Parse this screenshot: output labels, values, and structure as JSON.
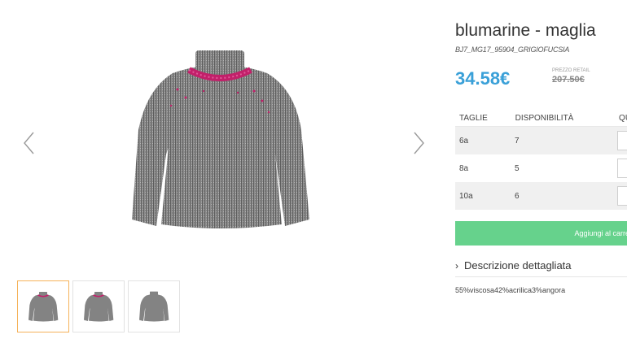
{
  "product": {
    "title": "blumarine - maglia",
    "sku": "BJ7_MG17_95904_GRIGIOFUCSIA",
    "price": "34.58€",
    "retail_label": "PREZZO RETAIL",
    "retail_price": "207.50€"
  },
  "gallery": {
    "prev_icon": "chevron-left-icon",
    "next_icon": "chevron-right-icon",
    "thumbnails": [
      "sweater-front-thumbnail",
      "sweater-detail-thumbnail",
      "sweater-back-thumbnail"
    ],
    "active_thumbnail": 0
  },
  "sizes_table": {
    "headers": [
      "TAGLIE",
      "DISPONIBILITÀ",
      "QUANTITÀ"
    ],
    "rows": [
      {
        "size": "6a",
        "availability": "7"
      },
      {
        "size": "8a",
        "availability": "5"
      },
      {
        "size": "10a",
        "availability": "6"
      }
    ]
  },
  "cart": {
    "add_label": "Aggiungi al carrello"
  },
  "description": {
    "toggle_label": "Descrizione dettagliata",
    "text": "55%viscosa42%acrilica3%angora"
  },
  "colors": {
    "price": "#3aa0d8",
    "cart_button": "#66d28c",
    "active_thumb_border": "#f5b25a",
    "sweater_grey": "#8a8a8a",
    "sweater_fuchsia": "#c2206a"
  }
}
